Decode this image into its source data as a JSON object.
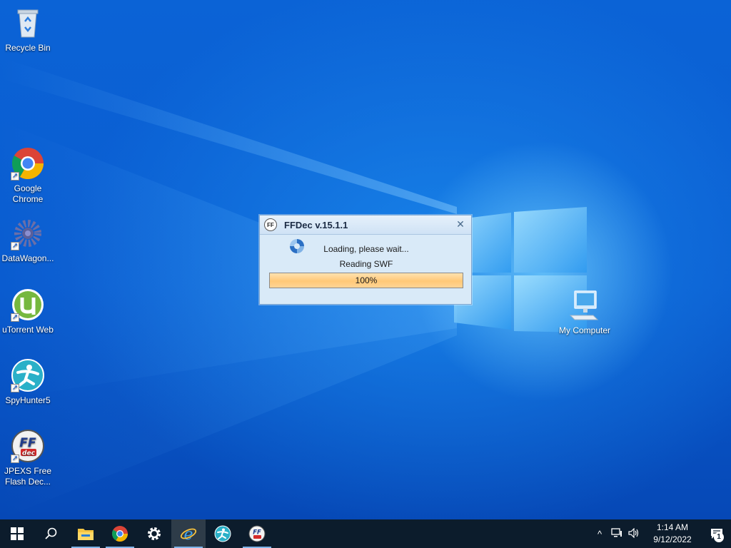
{
  "desktop": {
    "icons": [
      {
        "label": "Recycle Bin",
        "icon": "recycle-bin-icon"
      },
      {
        "label": "Google Chrome",
        "icon": "chrome-icon"
      },
      {
        "label": "DataWagon...",
        "icon": "datawagon-icon"
      },
      {
        "label": "uTorrent Web",
        "icon": "utorrent-icon"
      },
      {
        "label": "SpyHunter5",
        "icon": "spyhunter-icon"
      },
      {
        "label": "JPEXS Free Flash Dec...",
        "icon": "jpexs-ffdec-icon"
      },
      {
        "label": "My Computer",
        "icon": "my-computer-icon"
      }
    ]
  },
  "dialog": {
    "title": "FFDec v.15.1.1",
    "message": "Loading, please wait...",
    "status": "Reading SWF",
    "progress_text": "100%",
    "progress_value": 1.0,
    "app_icon_text": "FF",
    "close_symbol": "✕"
  },
  "taskbar": {
    "apps": [
      {
        "name": "start",
        "icon": "windows-start-icon"
      },
      {
        "name": "search",
        "icon": "search-icon"
      },
      {
        "name": "file-explorer",
        "icon": "folder-icon"
      },
      {
        "name": "chrome",
        "icon": "chrome-icon"
      },
      {
        "name": "settings",
        "icon": "gear-icon"
      },
      {
        "name": "internet-explorer",
        "icon": "internet-explorer-icon"
      },
      {
        "name": "spyhunter",
        "icon": "spyhunter-icon"
      },
      {
        "name": "ffdec",
        "icon": "jpexs-ffdec-icon"
      }
    ],
    "tray": {
      "chevron": "^",
      "time": "1:14 AM",
      "date": "9/12/2022",
      "notification_count": "1"
    }
  },
  "colors": {
    "desktop_blue": "#0a5fd0",
    "taskbar": "#0c1c2c",
    "dialog_bg": "#d9eaf8",
    "progress_fill": "#ffc878"
  }
}
